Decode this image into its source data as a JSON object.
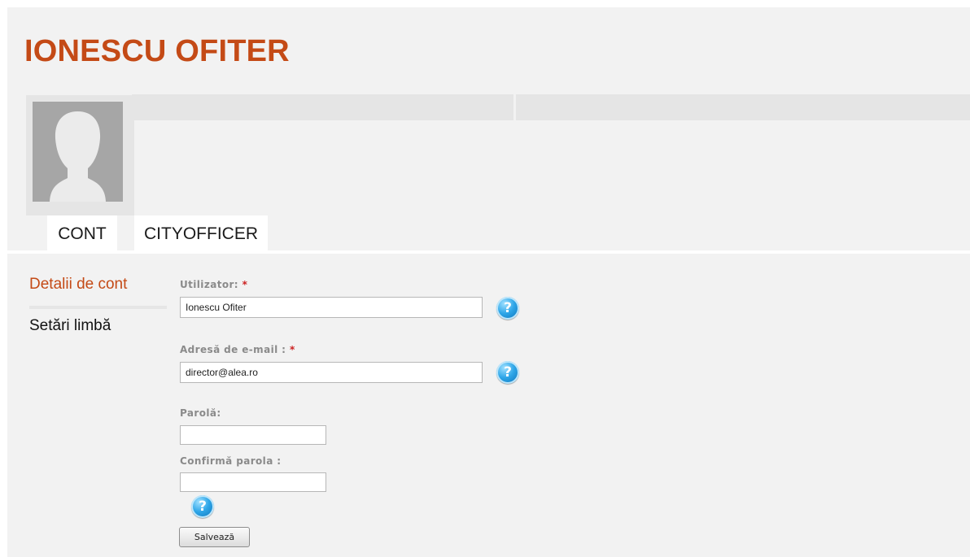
{
  "profile": {
    "name": "IONESCU OFITER"
  },
  "tabs": [
    {
      "label": "CONT"
    },
    {
      "label": "CITYOFFICER"
    }
  ],
  "sidebar": {
    "items": [
      {
        "label": "Detalii de cont",
        "active": true
      },
      {
        "label": "Setări limbă",
        "active": false
      }
    ]
  },
  "form": {
    "username": {
      "label": "Utilizator:",
      "required_mark": "*",
      "value": "Ionescu Ofiter"
    },
    "email": {
      "label": "Adresă de e-mail :",
      "required_mark": "*",
      "value": "director@alea.ro"
    },
    "password": {
      "label": "Parolă:",
      "value": ""
    },
    "confirm_password": {
      "label": "Confirmă parola :",
      "value": ""
    },
    "save_label": "Salvează"
  },
  "colors": {
    "accent": "#c44a16",
    "panel_bg": "#f2f2f2",
    "help_icon": "#2ea6e8",
    "required": "#cc2222"
  },
  "icons": {
    "help": "help-icon",
    "avatar": "avatar-placeholder-icon"
  }
}
